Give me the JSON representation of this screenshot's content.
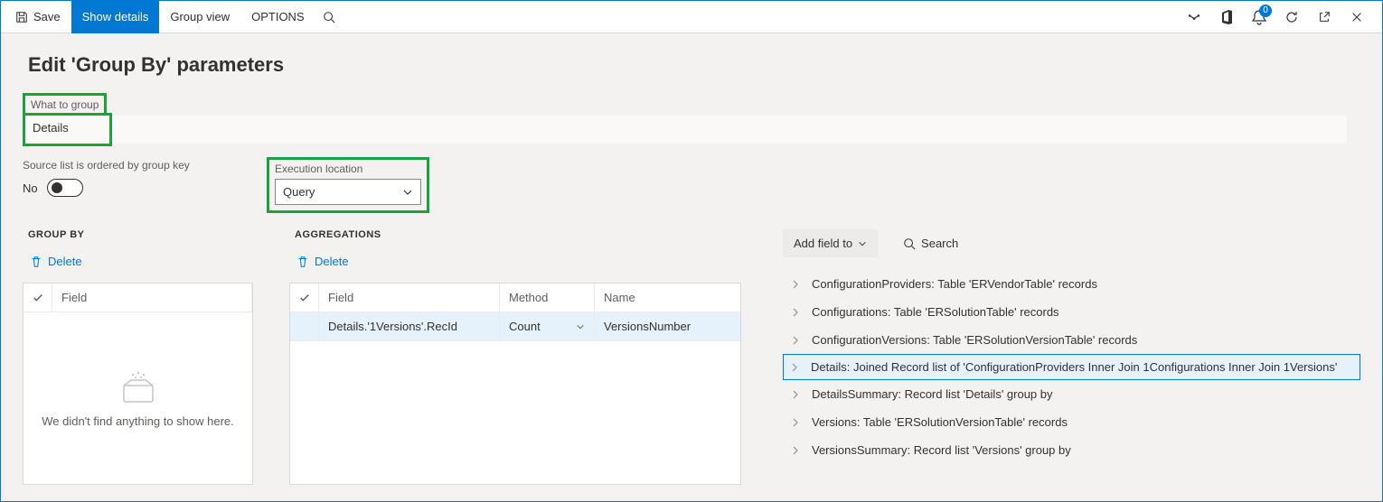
{
  "toolbar": {
    "save": "Save",
    "show_details": "Show details",
    "group_view": "Group view",
    "options": "OPTIONS",
    "notif_count": "0"
  },
  "page_title": "Edit 'Group By' parameters",
  "what_to_group": {
    "label": "What to group",
    "value": "Details"
  },
  "ordered": {
    "label": "Source list is ordered by group key",
    "value": "No"
  },
  "exec_loc": {
    "label": "Execution location",
    "value": "Query"
  },
  "group_by": {
    "header": "GROUP BY",
    "delete": "Delete",
    "col_field": "Field",
    "empty": "We didn't find anything to show here."
  },
  "aggregations": {
    "header": "AGGREGATIONS",
    "delete": "Delete",
    "col_field": "Field",
    "col_method": "Method",
    "col_name": "Name",
    "rows": [
      {
        "field": "Details.'1Versions'.RecId",
        "method": "Count",
        "name": "VersionsNumber"
      }
    ]
  },
  "right": {
    "add_field_to": "Add field to",
    "search": "Search",
    "items": [
      "ConfigurationProviders: Table 'ERVendorTable' records",
      "Configurations: Table 'ERSolutionTable' records",
      "ConfigurationVersions: Table 'ERSolutionVersionTable' records",
      "Details: Joined Record list of 'ConfigurationProviders Inner Join 1Configurations Inner Join 1Versions'",
      "DetailsSummary: Record list 'Details' group by",
      "Versions: Table 'ERSolutionVersionTable' records",
      "VersionsSummary: Record list 'Versions' group by"
    ],
    "selected_index": 3
  }
}
